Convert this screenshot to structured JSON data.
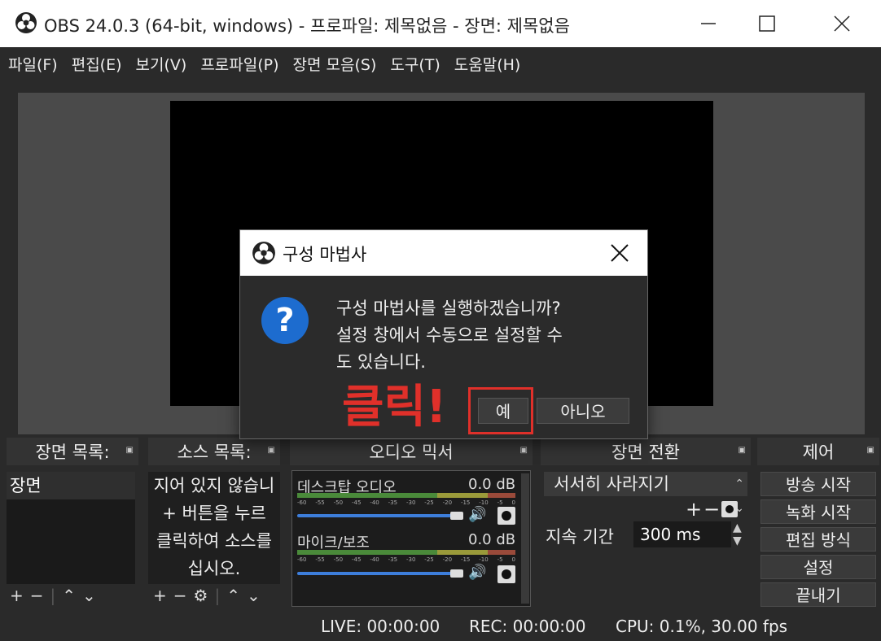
{
  "window": {
    "title": "OBS 24.0.3 (64-bit, windows) - 프로파일: 제목없음 - 장면: 제목없음"
  },
  "menu": [
    "파일(F)",
    "편집(E)",
    "보기(V)",
    "프로파일(P)",
    "장면 모음(S)",
    "도구(T)",
    "도움말(H)"
  ],
  "docks": {
    "scenes": {
      "title": "장면 목록:",
      "items": [
        "장면"
      ]
    },
    "sources": {
      "title": "소스 목록:",
      "hint_lines": [
        "지어 있지 않습니",
        "+ 버튼을 누르",
        "클릭하여 소스를",
        "십시오."
      ]
    },
    "mixer": {
      "title": "오디오 믹서",
      "channels": [
        {
          "name": "데스크탑 오디오",
          "db": "0.0 dB"
        },
        {
          "name": "마이크/보조",
          "db": "0.0 dB"
        }
      ],
      "scale": [
        "-60",
        "-55",
        "-50",
        "-45",
        "-40",
        "-35",
        "-30",
        "-25",
        "-20",
        "-15",
        "-10",
        "-5",
        "0"
      ]
    },
    "transitions": {
      "title": "장면 전환",
      "selected": "서서히 사라지기",
      "duration_label": "지속 기간",
      "duration_value": "300 ms"
    },
    "controls": {
      "title": "제어",
      "buttons": [
        "방송 시작",
        "녹화 시작",
        "편집 방식",
        "설정",
        "끝내기"
      ]
    }
  },
  "status": {
    "live": "LIVE: 00:00:00",
    "rec": "REC: 00:00:00",
    "cpu": "CPU: 0.1%, 30.00 fps"
  },
  "dialog": {
    "title": "구성 마법사",
    "message_lines": [
      "구성 마법사를 실행하겠습니까?",
      "설정 창에서 수동으로 설정할 수",
      "도 있습니다."
    ],
    "yes": "예",
    "no": "아니오"
  },
  "annotation": {
    "text": "클릭!"
  },
  "colors": {
    "accent": "#3d7edb",
    "annotation": "#e0302a",
    "question": "#1d6ccf"
  }
}
